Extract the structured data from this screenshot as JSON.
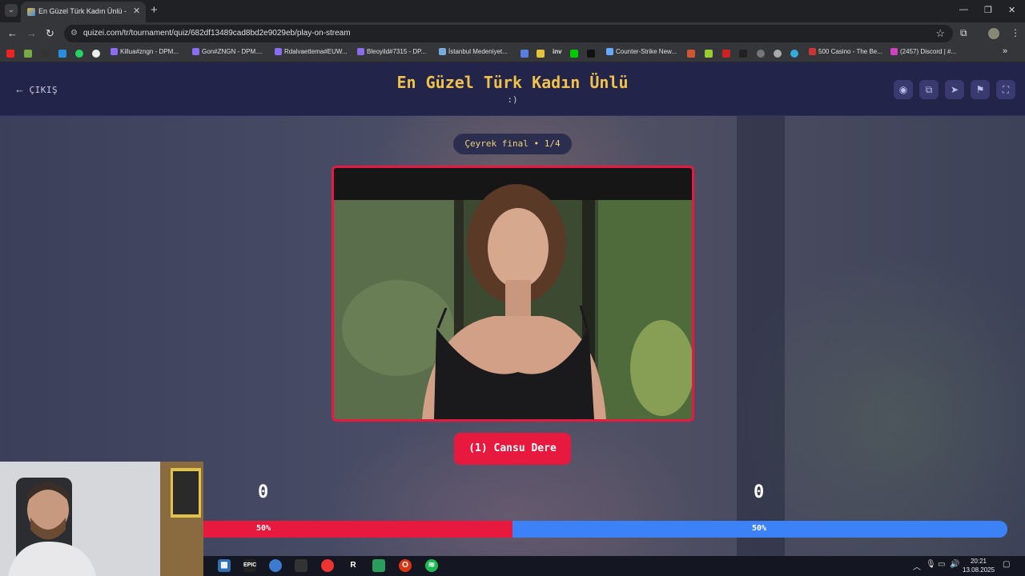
{
  "browser": {
    "tab_title": "En Güzel Türk Kadın Ünlü - Quiz",
    "url": "quizei.com/tr/tournament/quiz/682df13489cad8bd2e9029eb/play-on-stream",
    "bookmarks": [
      "Killua#zngn - DPM...",
      "Gon#ZNGN - DPM....",
      "Rdalvaettema#EUW...",
      "Bleoyild#7315 - DP...",
      "İstanbul Medeniyet...",
      "Counter-Strike New...",
      "500 Casino - The Be...",
      "(2457) Discord | #..."
    ],
    "bookmark_short": [
      "inv"
    ]
  },
  "header": {
    "exit_label": "ÇIKIŞ",
    "title": "En Güzel Türk Kadın Ünlü",
    "subtitle": ":)",
    "actions": [
      "eye-icon",
      "share-icon",
      "send-icon",
      "flag-icon",
      "fullscreen-icon"
    ]
  },
  "stage": {
    "round_label": "Çeyrek final • 1/4",
    "candidate_label": "(1) Cansu Dere",
    "left_score": "0",
    "right_score": "0",
    "left_percent_label": "50%",
    "right_percent_label": "50%",
    "left_share": 0.384,
    "colors": {
      "left": "#e8193e",
      "right": "#3c82f6",
      "title": "#f0c24a"
    }
  },
  "taskbar": {
    "apps": [
      "calculator-icon",
      "epic-icon",
      "app-icon",
      "app-icon",
      "app-icon",
      "R",
      "app-icon",
      "opera-icon",
      "spotify-icon"
    ],
    "time": "20:21",
    "date": "13.08.2025"
  }
}
